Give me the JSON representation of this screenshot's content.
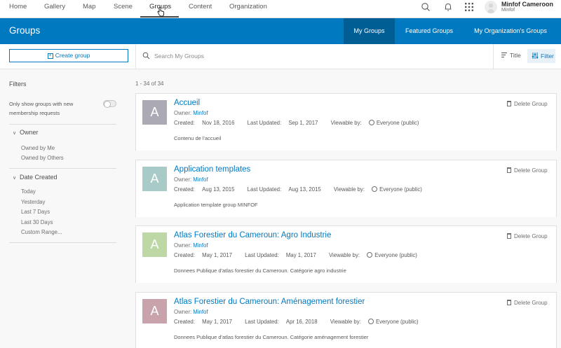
{
  "top_nav": {
    "items": [
      {
        "label": "Home"
      },
      {
        "label": "Gallery"
      },
      {
        "label": "Map"
      },
      {
        "label": "Scene"
      },
      {
        "label": "Groups"
      },
      {
        "label": "Content"
      },
      {
        "label": "Organization"
      }
    ],
    "active": "Groups",
    "user": {
      "name": "Minfof Cameroon",
      "org": "Minfof"
    }
  },
  "header": {
    "title": "Groups",
    "tabs": [
      {
        "label": "My Groups"
      },
      {
        "label": "Featured Groups"
      },
      {
        "label": "My Organization's Groups"
      }
    ],
    "active_tab": "My Groups",
    "color": "#0079c1",
    "active_color": "#005e95"
  },
  "toolbar": {
    "create_label": "Create group",
    "search_placeholder": "Search My Groups",
    "sort_label": "Title",
    "filter_label": "Filter"
  },
  "sidebar": {
    "title": "Filters",
    "toggle_label": "Only show groups with new membership requests",
    "toggle_on": false,
    "sections": [
      {
        "label": "Owner",
        "options": [
          "Owned by Me",
          "Owned by Others"
        ]
      },
      {
        "label": "Date Created",
        "options": [
          "Today",
          "Yesterday",
          "Last 7 Days",
          "Last 30 Days",
          "Custom Range..."
        ]
      }
    ]
  },
  "results": {
    "count_text": "1 - 34 of 34",
    "delete_label": "Delete Group",
    "owner_prefix": "Owner: ",
    "created_prefix": "Created: ",
    "updated_prefix": "Last Updated: ",
    "viewable_prefix": "Viewable by: ",
    "groups": [
      {
        "letter": "A",
        "color": "#aaa9b4",
        "title": "Accueil",
        "owner": "Minfof",
        "created": "Nov 18, 2016",
        "updated": "Sep 1, 2017",
        "viewable": "Everyone (public)",
        "description": "Contenu de l'accueil"
      },
      {
        "letter": "A",
        "color": "#a9cbc7",
        "title": "Application templates",
        "owner": "Minfof",
        "created": "Aug 13, 2015",
        "updated": "Aug 13, 2015",
        "viewable": "Everyone (public)",
        "description": "Application template group MINFOF"
      },
      {
        "letter": "A",
        "color": "#bdd7a5",
        "title": "Atlas Forestier du Cameroun: Agro Industrie",
        "owner": "Minfof",
        "created": "May 1, 2017",
        "updated": "May 1, 2017",
        "viewable": "Everyone (public)",
        "description": "Donnees Publique d'atlas forestier du Cameroun. Catégorie agro industrie"
      },
      {
        "letter": "A",
        "color": "#c9a3ab",
        "title": "Atlas Forestier du Cameroun: Aménagement forestier",
        "owner": "Minfof",
        "created": "May 1, 2017",
        "updated": "Apr 16, 2018",
        "viewable": "Everyone (public)",
        "description": "Donnees Publique d'atlas forestier du Cameroun. Catégorie aménagement forestier"
      }
    ]
  }
}
